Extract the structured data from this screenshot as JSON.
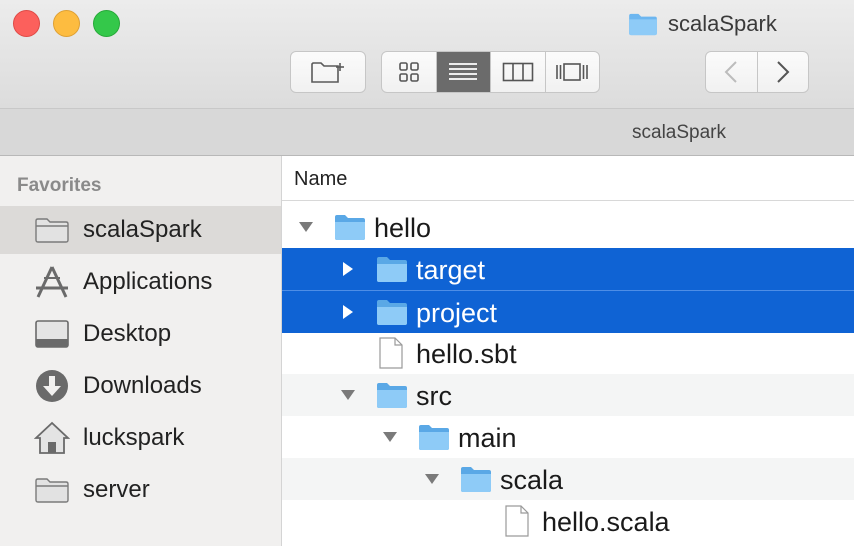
{
  "window": {
    "title": "scalaSpark"
  },
  "pathbar": {
    "label": "scalaSpark"
  },
  "sidebar": {
    "heading": "Favorites",
    "items": [
      {
        "label": "scalaSpark",
        "icon": "folder-icon",
        "selected": true
      },
      {
        "label": "Applications",
        "icon": "applications-icon"
      },
      {
        "label": "Desktop",
        "icon": "desktop-icon"
      },
      {
        "label": "Downloads",
        "icon": "downloads-icon"
      },
      {
        "label": "luckspark",
        "icon": "home-icon"
      },
      {
        "label": "server",
        "icon": "folder-icon"
      }
    ]
  },
  "list": {
    "column_name": "Name",
    "rows": [
      {
        "name": "hello",
        "type": "folder",
        "expanded": true,
        "depth": 0
      },
      {
        "name": "target",
        "type": "folder",
        "expanded": false,
        "depth": 1,
        "selected": true
      },
      {
        "name": "project",
        "type": "folder",
        "expanded": false,
        "depth": 1,
        "selected": true
      },
      {
        "name": "hello.sbt",
        "type": "file",
        "depth": 1
      },
      {
        "name": "src",
        "type": "folder",
        "expanded": true,
        "depth": 1
      },
      {
        "name": "main",
        "type": "folder",
        "expanded": true,
        "depth": 2
      },
      {
        "name": "scala",
        "type": "folder",
        "expanded": true,
        "depth": 3
      },
      {
        "name": "hello.scala",
        "type": "file",
        "depth": 4
      }
    ]
  },
  "colors": {
    "selection": "#0f63d4",
    "folder": "#6cb6f0"
  }
}
